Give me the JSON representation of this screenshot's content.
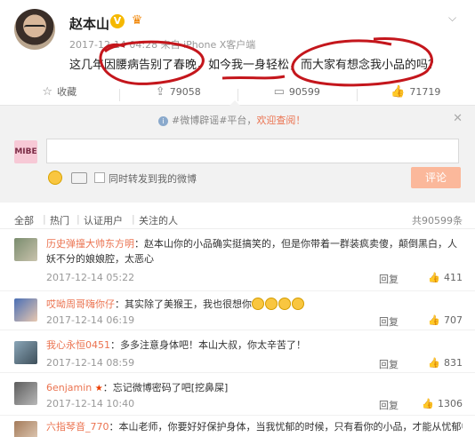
{
  "post": {
    "username": "赵本山",
    "vip_badge": "V",
    "meta": "2017-12-14 04:28 来自 iPhone X客户端",
    "content": "这几年因腰病告别了春晚，如今我一身轻松，而大家有想念我小品的吗？"
  },
  "actions": {
    "favorite": "收藏",
    "repost": "79058",
    "comment": "90599",
    "like": "71719"
  },
  "tip": {
    "prefix": "#微博辟谣#平台，",
    "link": "欢迎查阅！"
  },
  "compose": {
    "avatar_text": "MIBE",
    "input_value": "",
    "repost_label": "同时转发到我的微博",
    "submit_label": "评论"
  },
  "tabs": {
    "all": "全部",
    "hot": "热门",
    "verified": "认证用户",
    "followed": "关注的人",
    "total": "共90599条"
  },
  "comments": [
    {
      "user": "历史弹撞大帅东方明",
      "text": "：赵本山你的小品确实挺搞笑的，但是你带着一群装疯卖傻，颠倒黑白，人妖不分的娘娘腔，太恶心",
      "time": "2017-12-14 05:22",
      "reply": "回复",
      "likes": "411"
    },
    {
      "user": "哎呦周哥嗨你仔",
      "text": "：其实除了美猴王，我也很想你",
      "time": "2017-12-14 06:19",
      "reply": "回复",
      "likes": "707"
    },
    {
      "user": "我心永恒0451",
      "text": "：多多注意身体吧！本山大叔，你太辛苦了！",
      "time": "2017-12-14 08:59",
      "reply": "回复",
      "likes": "831"
    },
    {
      "user": "6enjamin",
      "text": "：忘记微博密码了吧[挖鼻屎]",
      "time": "2017-12-14 10:40",
      "reply": "回复",
      "likes": "1306"
    },
    {
      "user": "六指琴音_770",
      "text": "：本山老师，你要好好保护身体，当我忧郁的时候，只有看你的小品，才能从忧郁中",
      "time": "",
      "reply": "",
      "likes": ""
    }
  ],
  "colors": {
    "accent": "#eb7350",
    "annotation": "#c4161c"
  }
}
